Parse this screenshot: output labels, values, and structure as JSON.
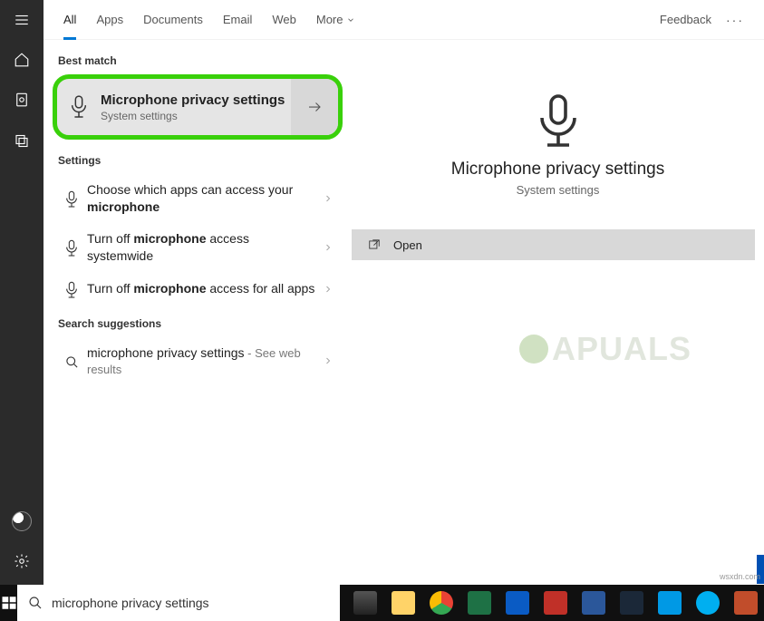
{
  "tabs": {
    "all": "All",
    "apps": "Apps",
    "documents": "Documents",
    "email": "Email",
    "web": "Web",
    "more": "More",
    "feedback": "Feedback"
  },
  "sections": {
    "best_match": "Best match",
    "settings": "Settings",
    "suggestions": "Search suggestions"
  },
  "best": {
    "title": "Microphone privacy settings",
    "subtitle": "System settings"
  },
  "settings_rows": [
    {
      "pre": "Choose which apps can access your ",
      "bold": "microphone"
    },
    {
      "pre": "Turn off ",
      "bold": "microphone",
      "post": " access systemwide"
    },
    {
      "pre": "Turn off ",
      "bold": "microphone",
      "post": " access for all apps"
    }
  ],
  "suggestion": {
    "query": "microphone privacy settings",
    "tail": " - See web results"
  },
  "detail": {
    "title": "Microphone privacy settings",
    "subtitle": "System settings",
    "open": "Open"
  },
  "search": {
    "value": "microphone privacy settings"
  },
  "watermark": "APUALS",
  "credit": "wsxdn.com"
}
